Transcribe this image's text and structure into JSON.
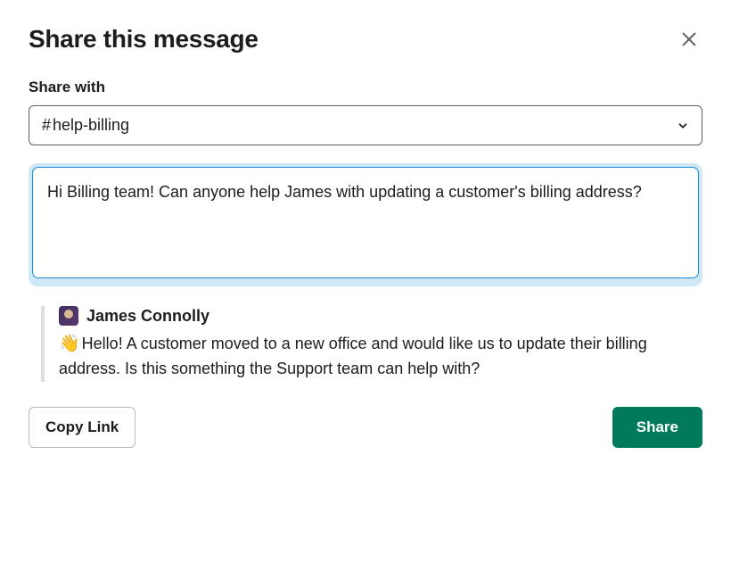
{
  "modal": {
    "title": "Share this message",
    "field_label": "Share with"
  },
  "channel_select": {
    "prefix": "#",
    "name": "help-billing"
  },
  "message_input": {
    "value": "Hi Billing team! Can anyone help James with updating a customer's billing address?"
  },
  "quoted": {
    "author": "James Connolly",
    "emoji": "👋",
    "body": "Hello! A customer moved to a new office and would like us to update their billing address. Is this something the Support team can help with?"
  },
  "footer": {
    "copy_link_label": "Copy Link",
    "share_label": "Share"
  }
}
